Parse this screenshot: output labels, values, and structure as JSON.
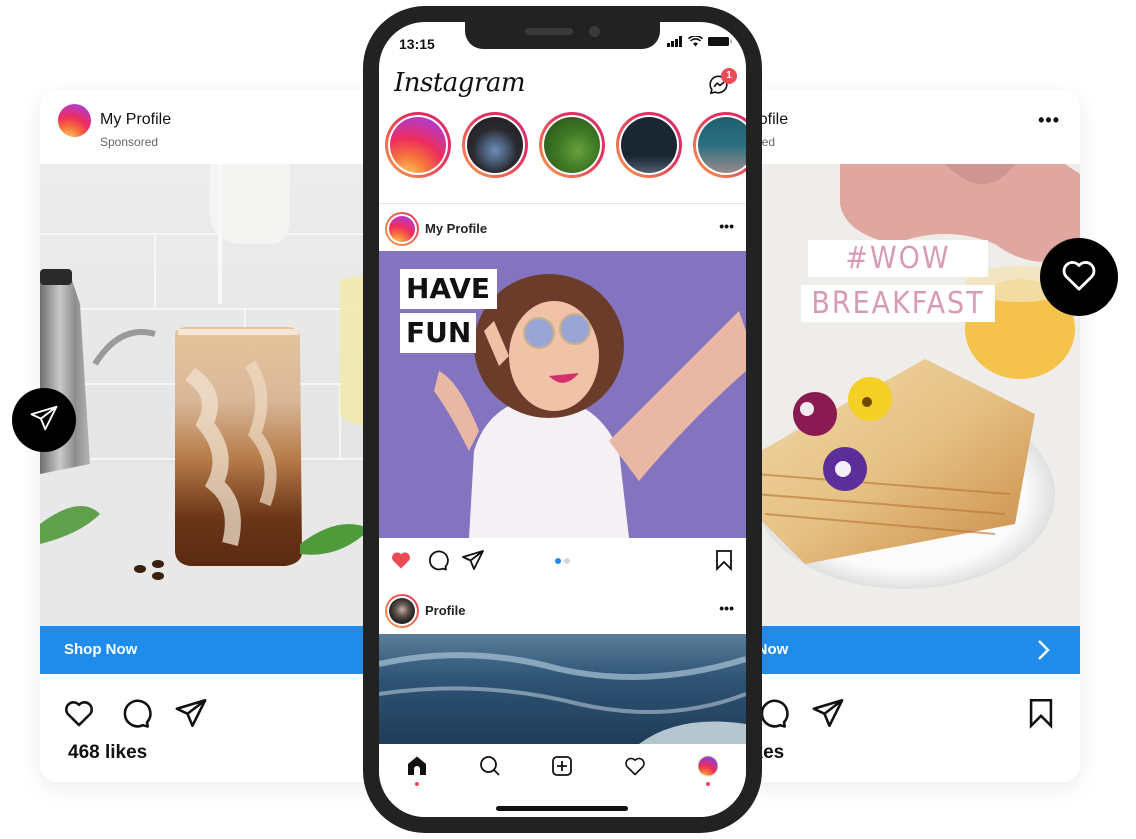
{
  "left_card": {
    "profile_name": "My Profile",
    "sponsored_label": "Sponsored",
    "cta_label": "Shop Now",
    "likes_label": "468 likes",
    "image_description": "iced coffee with milk being poured"
  },
  "right_card": {
    "profile_name": "My Profile",
    "sponsored_label": "Sponsored",
    "more_label": "•••",
    "cta_label": "Shop Now",
    "likes_label": "468 likes",
    "overlay_line1": "#WOW",
    "overlay_line2": "BREAKFAST",
    "image_description": "crepes with edible pansies and honey jar"
  },
  "floating": {
    "send_icon": "send-icon",
    "heart_icon": "heart-icon"
  },
  "phone": {
    "status": {
      "time": "13:15"
    },
    "app_title": "Instagram",
    "messenger_badge": "1",
    "stories": [
      {
        "name": "my-story",
        "kind": "gradient"
      },
      {
        "name": "story-person-denim",
        "kind": "photo"
      },
      {
        "name": "story-leaves",
        "kind": "photo"
      },
      {
        "name": "story-building",
        "kind": "photo"
      },
      {
        "name": "story-moon",
        "kind": "photo"
      }
    ],
    "post1": {
      "profile_name": "My Profile",
      "more_label": "•••",
      "overlay_line1": "HAVE",
      "overlay_line2": "FUN",
      "liked": true,
      "carousel_index": 1,
      "carousel_total": 2
    },
    "post2": {
      "profile_name": "Profile",
      "more_label": "•••"
    },
    "tabbar": [
      "home",
      "search",
      "new-post",
      "activity",
      "profile"
    ]
  },
  "colors": {
    "cta_blue": "#1f8ceb",
    "like_red": "#ed4956",
    "carousel_active": "#1a8cf5",
    "overlay_pink": "#d79bb5",
    "post_bg_purple": "#8474c0"
  }
}
